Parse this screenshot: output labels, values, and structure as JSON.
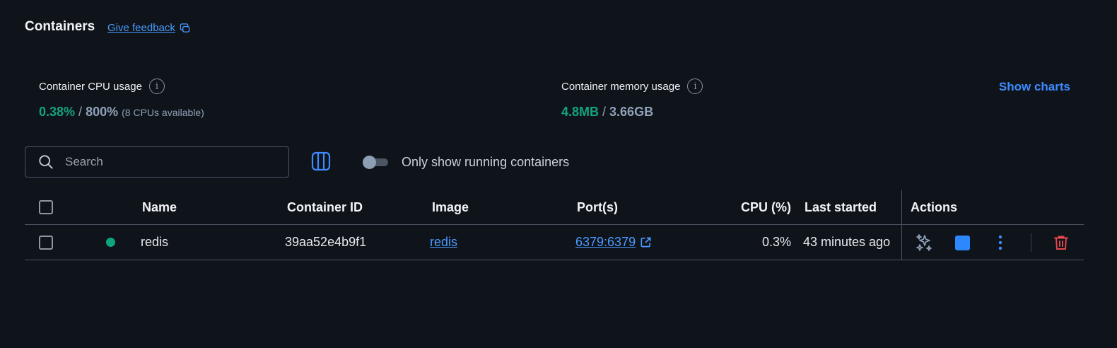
{
  "header": {
    "title": "Containers",
    "feedback_label": "Give feedback"
  },
  "stats": {
    "cpu": {
      "label": "Container CPU usage",
      "used": "0.38%",
      "separator": " / ",
      "total": "800%",
      "note": "(8 CPUs available)"
    },
    "memory": {
      "label": "Container memory usage",
      "used": "4.8MB",
      "separator": " / ",
      "total": "3.66GB"
    },
    "show_charts_label": "Show charts"
  },
  "toolbar": {
    "search_placeholder": "Search",
    "toggle_label": "Only show running containers",
    "toggle_on": false
  },
  "table": {
    "headers": {
      "name": "Name",
      "container_id": "Container ID",
      "image": "Image",
      "ports": "Port(s)",
      "cpu": "CPU (%)",
      "last_started": "Last started",
      "actions": "Actions"
    },
    "rows": [
      {
        "name": "redis",
        "status": "running",
        "container_id": "39aa52e4b9f1",
        "image": "redis",
        "ports": "6379:6379",
        "cpu": "0.3%",
        "last_started": "43 minutes ago"
      }
    ]
  },
  "colors": {
    "background": "#0f131a",
    "accent": "#3d8cff",
    "running": "#10a37f",
    "delete": "#e5484d"
  }
}
